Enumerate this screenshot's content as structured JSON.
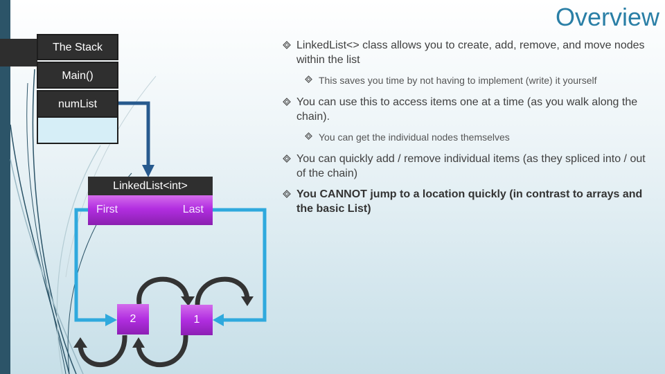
{
  "slide": {
    "title": "Overview"
  },
  "stack": {
    "header": "The Stack",
    "frame": "Main()",
    "variable": "numList"
  },
  "linked_list": {
    "header": "LinkedList<int>",
    "first_label": "First",
    "last_label": "Last",
    "nodes": [
      {
        "value": "2"
      },
      {
        "value": "1"
      }
    ]
  },
  "bullets": [
    {
      "text": "LinkedList<> class allows you to create, add, remove, and move nodes within the list",
      "level": 1,
      "bold": false
    },
    {
      "text": "This saves you time by not having to implement (write) it yourself",
      "level": 2,
      "bold": false
    },
    {
      "text": "You can use this to access items one at a time (as you walk along the chain).",
      "level": 1,
      "bold": false
    },
    {
      "text": "You can get the individual nodes themselves",
      "level": 2,
      "bold": false
    },
    {
      "text": "You can quickly add / remove individual items (as they spliced into / out of the chain)",
      "level": 1,
      "bold": false
    },
    {
      "text": "You CANNOT jump to a location quickly (in contrast to arrays and the basic List)",
      "level": 1,
      "bold": true
    }
  ],
  "colors": {
    "accent": "#2a7fa6",
    "sidebar": "#2c5468",
    "node_purple": "#b22ee0",
    "pointer_blue": "#2e9fd8",
    "reference_arrow": "#275a8e"
  }
}
